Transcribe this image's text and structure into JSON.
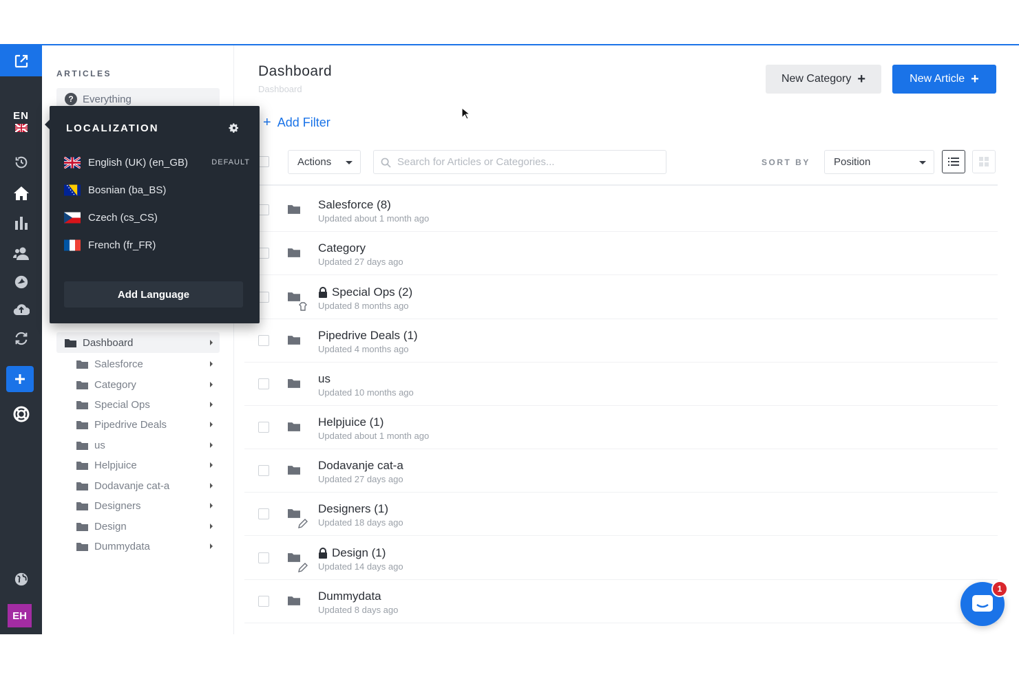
{
  "rail": {
    "lang_code": "EN",
    "avatar_initials": "EH",
    "accent": "#1a73e8"
  },
  "sidebar": {
    "section_title": "ARTICLES",
    "everything_label": "Everything",
    "root": {
      "label": "Dashboard"
    },
    "items": [
      {
        "label": "Salesforce"
      },
      {
        "label": "Category"
      },
      {
        "label": "Special Ops"
      },
      {
        "label": "Pipedrive Deals"
      },
      {
        "label": "us"
      },
      {
        "label": "Helpjuice"
      },
      {
        "label": "Dodavanje cat-a"
      },
      {
        "label": "Designers"
      },
      {
        "label": "Design"
      },
      {
        "label": "Dummydata"
      }
    ]
  },
  "localization": {
    "title": "LOCALIZATION",
    "default_tag": "DEFAULT",
    "languages": [
      {
        "label": "English (UK) (en_GB)",
        "flag": "gb-flag"
      },
      {
        "label": "Bosnian (ba_BS)",
        "flag": "ba-flag"
      },
      {
        "label": "Czech (cs_CS)",
        "flag": "cz-flag"
      },
      {
        "label": "French (fr_FR)",
        "flag": "fr-flag"
      }
    ],
    "add_label": "Add Language"
  },
  "header": {
    "title": "Dashboard",
    "breadcrumb": "Dashboard",
    "new_category_label": "New Category",
    "new_article_label": "New Article"
  },
  "filter": {
    "add_label": "Add Filter"
  },
  "toolbar": {
    "actions_label": "Actions",
    "search_placeholder": "Search for Articles or Categories...",
    "sort_by_label": "SORT BY",
    "sort_value": "Position"
  },
  "rows": [
    {
      "name": "Salesforce (8)",
      "updated": "Updated about 1 month ago",
      "locked": false,
      "badge": ""
    },
    {
      "name": "Category",
      "updated": "Updated 27 days ago",
      "locked": false,
      "badge": ""
    },
    {
      "name": "Special Ops (2)",
      "updated": "Updated 8 months ago",
      "locked": true,
      "badge": "shield-icon"
    },
    {
      "name": "Pipedrive Deals (1)",
      "updated": "Updated 4 months ago",
      "locked": false,
      "badge": ""
    },
    {
      "name": "us",
      "updated": "Updated 10 months ago",
      "locked": false,
      "badge": ""
    },
    {
      "name": "Helpjuice (1)",
      "updated": "Updated about 1 month ago",
      "locked": false,
      "badge": ""
    },
    {
      "name": "Dodavanje cat-a",
      "updated": "Updated 27 days ago",
      "locked": false,
      "badge": ""
    },
    {
      "name": "Designers (1)",
      "updated": "Updated 18 days ago",
      "locked": false,
      "badge": "pencil-icon"
    },
    {
      "name": "Design (1)",
      "updated": "Updated 14 days ago",
      "locked": true,
      "badge": "pencil-icon"
    },
    {
      "name": "Dummydata",
      "updated": "Updated 8 days ago",
      "locked": false,
      "badge": ""
    }
  ],
  "chat": {
    "unread_count": "1"
  }
}
